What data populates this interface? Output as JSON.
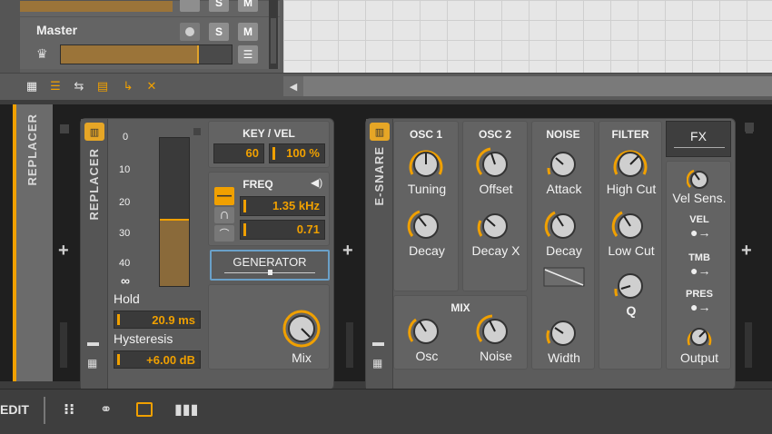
{
  "tracks": [
    {
      "name": "",
      "buttons": [
        "",
        "S",
        "M"
      ]
    },
    {
      "name": "Master",
      "buttons": [
        "",
        "S",
        "M"
      ]
    }
  ],
  "toolbar": {
    "scroll_left": "◀"
  },
  "chain": {
    "label": "REPLACER"
  },
  "replacer": {
    "title": "REPLACER",
    "meter_ticks": [
      "0",
      "10",
      "20",
      "30",
      "40",
      "∞"
    ],
    "hold_label": "Hold",
    "hold_value": "20.9 ms",
    "hysteresis_label": "Hysteresis",
    "hysteresis_value": "+6.00 dB",
    "keyvel_title": "KEY / VEL",
    "key_value": "60",
    "vel_value": "100 %",
    "freq_title": "FREQ",
    "freq_value": "1.35 kHz",
    "q_value": "0.71",
    "generator_label": "GENERATOR",
    "mix_label": "Mix"
  },
  "esnare": {
    "title": "E-SNARE",
    "osc1_title": "OSC 1",
    "osc1_tuning": "Tuning",
    "osc1_decay": "Decay",
    "osc2_title": "OSC 2",
    "osc2_offset": "Offset",
    "osc2_decayx": "Decay X",
    "noise_title": "NOISE",
    "noise_attack": "Attack",
    "noise_decay": "Decay",
    "noise_width": "Width",
    "filter_title": "FILTER",
    "filter_highcut": "High Cut",
    "filter_lowcut": "Low Cut",
    "filter_q": "Q",
    "mix_title": "MIX",
    "mix_osc": "Osc",
    "mix_noise": "Noise",
    "fx_label": "FX",
    "vel_sens": "Vel Sens.",
    "vel": "VEL",
    "tmb": "TMB",
    "pres": "PRES",
    "output": "Output"
  },
  "bottom": {
    "edit_label": "EDIT"
  },
  "colors": {
    "accent": "#f0a000",
    "panel": "#636363",
    "device_bg": "#5c5c5c"
  },
  "icons": [
    "grid-icon",
    "folder-icon",
    "plus-icon",
    "speaker-icon",
    "arrow-right-icon",
    "crown-icon",
    "menu-icon"
  ]
}
